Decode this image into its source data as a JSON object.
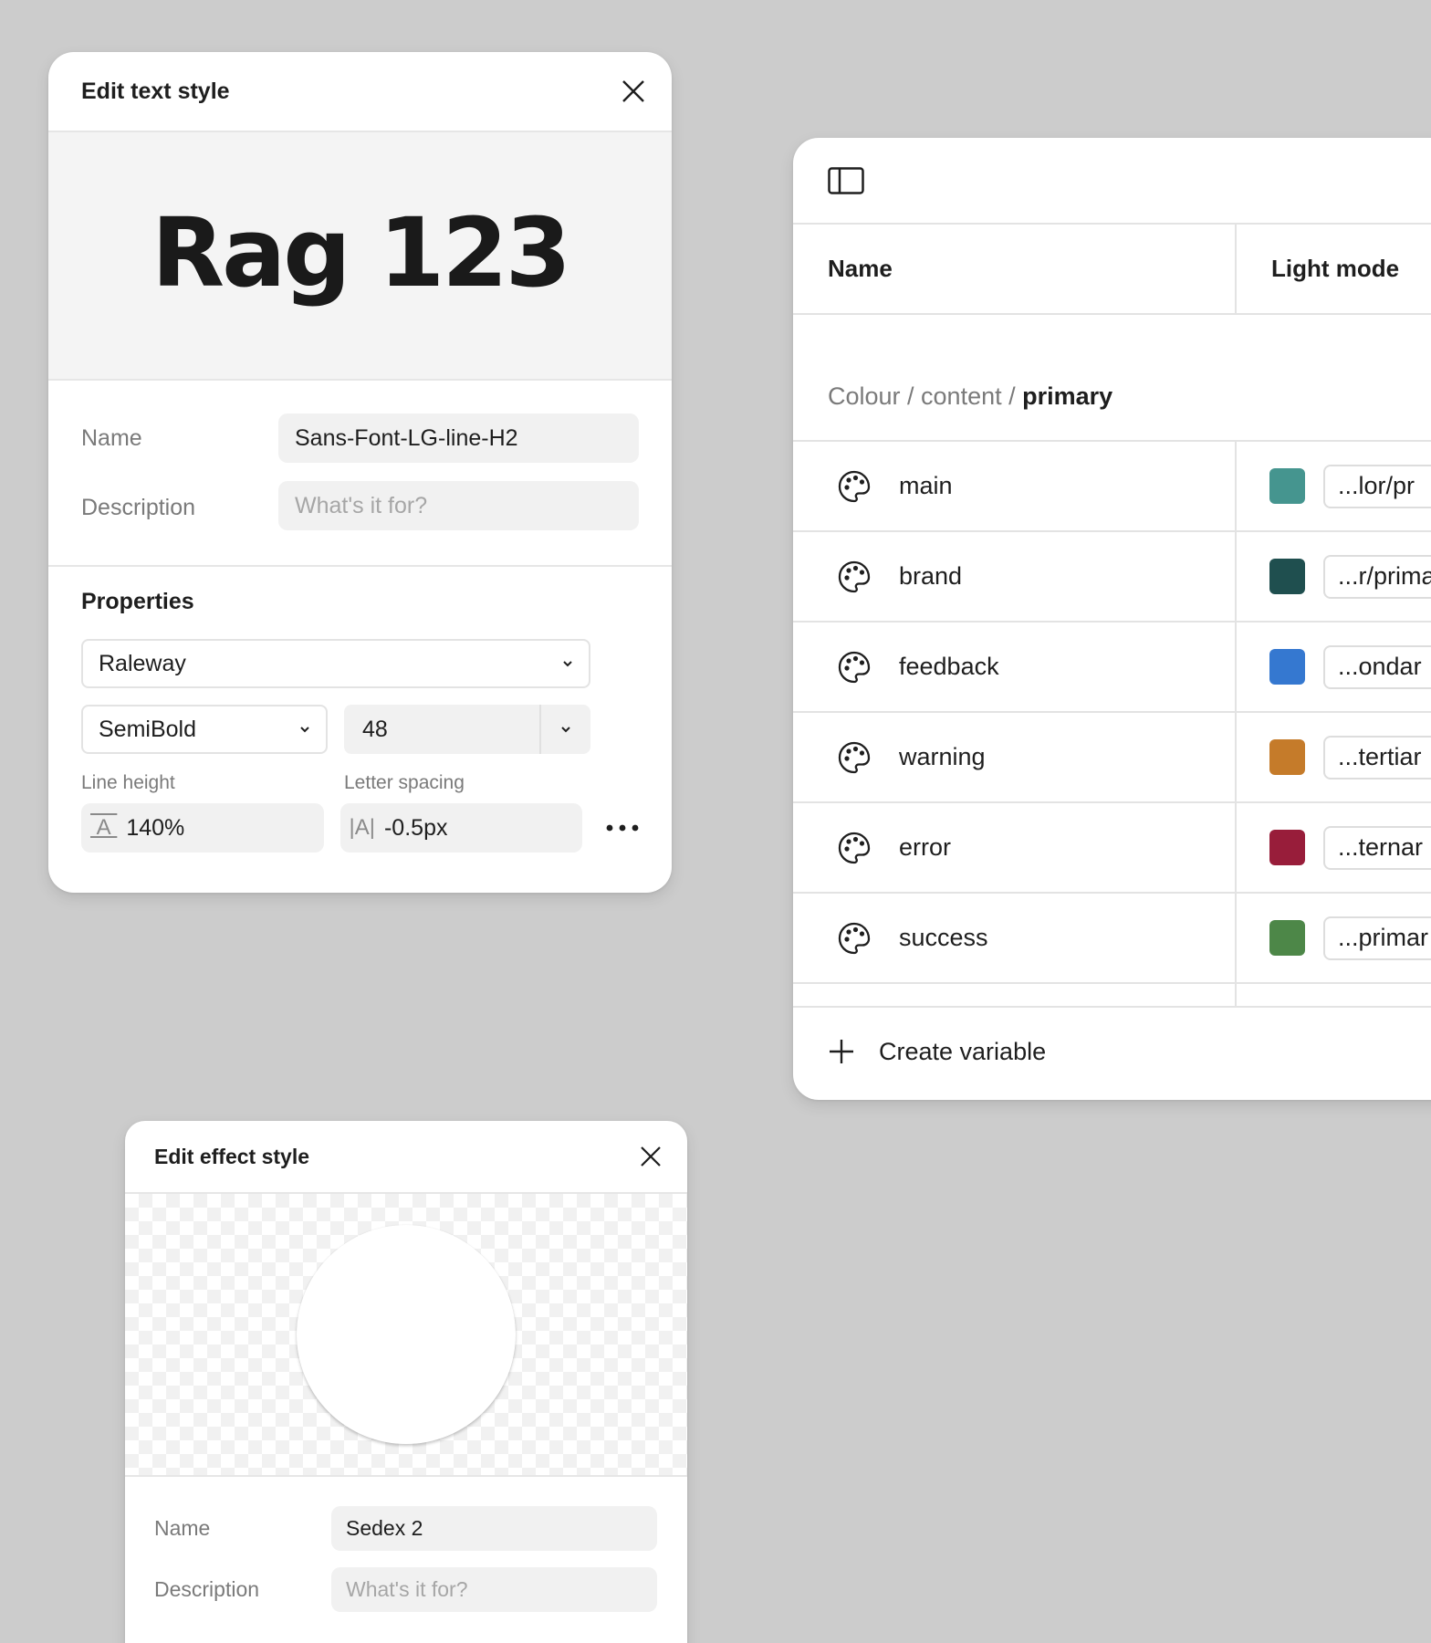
{
  "text_style_panel": {
    "title": "Edit text style",
    "preview_text": "Rag 123",
    "name_label": "Name",
    "name_value": "Sans-Font-LG-line-H2",
    "description_label": "Description",
    "description_placeholder": "What's it for?",
    "properties_title": "Properties",
    "font_family": "Raleway",
    "font_weight": "SemiBold",
    "font_size": "48",
    "line_height_label": "Line height",
    "line_height_value": "140%",
    "letter_spacing_label": "Letter spacing",
    "letter_spacing_value": "-0.5px"
  },
  "variables_panel": {
    "columns": [
      "Name",
      "Light mode"
    ],
    "group_path": "Colour / content / ",
    "group_name": "primary",
    "rows": [
      {
        "name": "main",
        "color": "#45958f",
        "alias": "...lor/pr"
      },
      {
        "name": "brand",
        "color": "#1f4f4f",
        "alias": "...r/prima"
      },
      {
        "name": "feedback",
        "color": "#3578d0",
        "alias": "...ondar"
      },
      {
        "name": "warning",
        "color": "#c57b2a",
        "alias": "...tertiar"
      },
      {
        "name": "error",
        "color": "#981d3a",
        "alias": "...ternar"
      },
      {
        "name": "success",
        "color": "#4d8748",
        "alias": "...primar"
      }
    ],
    "create_label": "Create variable"
  },
  "effect_style_panel": {
    "title": "Edit effect style",
    "name_label": "Name",
    "name_value": "Sedex 2",
    "description_label": "Description",
    "description_placeholder": "What's it for?"
  }
}
